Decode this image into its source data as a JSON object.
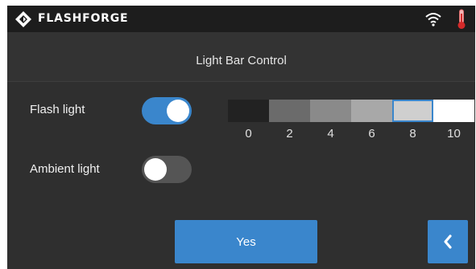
{
  "app": {
    "brand": "FLASHFORGE",
    "logo_icon": "flashforge-diamond-icon",
    "status_icons": [
      "wifi-icon",
      "thermometer-icon"
    ]
  },
  "page": {
    "title": "Light Bar Control"
  },
  "flash_light": {
    "label": "Flash light",
    "enabled": true
  },
  "ambient_light": {
    "label": "Ambient light",
    "enabled": false
  },
  "brightness": {
    "levels": [
      {
        "label": "0",
        "color": "#222222"
      },
      {
        "label": "2",
        "color": "#6b6b6b"
      },
      {
        "label": "4",
        "color": "#8a8a8a"
      },
      {
        "label": "6",
        "color": "#a8a8a8"
      },
      {
        "label": "8",
        "color": "#cfcfcf"
      },
      {
        "label": "10",
        "color": "#ffffff"
      }
    ],
    "selected": "8"
  },
  "actions": {
    "yes_label": "Yes",
    "back_icon": "chevron-left-icon"
  },
  "colors": {
    "accent": "#3a86cc",
    "background": "#2f2f2f",
    "topbar": "#1d1d1d"
  }
}
